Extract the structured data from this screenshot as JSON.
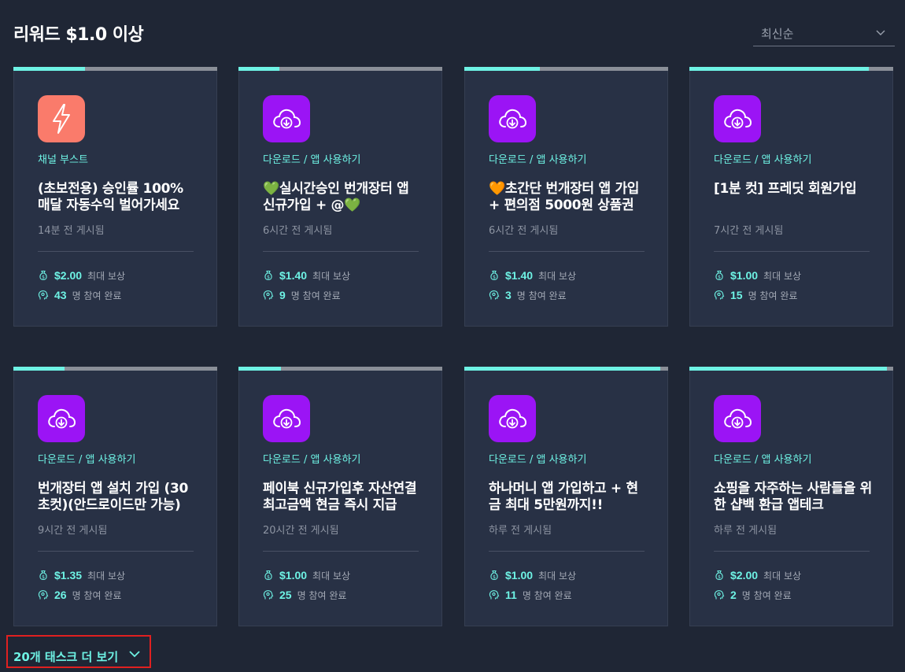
{
  "header": {
    "title": "리워드 $1.0 이상"
  },
  "sort": {
    "selected": "최신순"
  },
  "cards": [
    {
      "category": "채널 부스트",
      "title": "(초보전용) 승인률 100% 매달 자동수익 벌어가세요",
      "posted": "14분 전 게시됨",
      "reward": "$2.00",
      "reward_label": "최대 보상",
      "participants": "43",
      "participants_label": "명 참여 완료",
      "icon": "lightning-icon",
      "icon_color": "#fa7b6b",
      "progress": 0.35
    },
    {
      "category": "다운로드 / 앱 사용하기",
      "title": "💚실시간승인 번개장터 앱 신규가입 + @💚",
      "posted": "6시간 전 게시됨",
      "reward": "$1.40",
      "reward_label": "최대 보상",
      "participants": "9",
      "participants_label": "명 참여 완료",
      "icon": "cloud-download-icon",
      "icon_color": "#9b14f5",
      "progress": 0.2
    },
    {
      "category": "다운로드 / 앱 사용하기",
      "title": "🧡초간단 번개장터 앱 가입 + 편의점 5000원 상품권",
      "posted": "6시간 전 게시됨",
      "reward": "$1.40",
      "reward_label": "최대 보상",
      "participants": "3",
      "participants_label": "명 참여 완료",
      "icon": "cloud-download-icon",
      "icon_color": "#9b14f5",
      "progress": 0.37
    },
    {
      "category": "다운로드 / 앱 사용하기",
      "title": "[1분 컷] 프레딧 회원가입",
      "posted": "7시간 전 게시됨",
      "reward": "$1.00",
      "reward_label": "최대 보상",
      "participants": "15",
      "participants_label": "명 참여 완료",
      "icon": "cloud-download-icon",
      "icon_color": "#9b14f5",
      "progress": 0.88
    },
    {
      "category": "다운로드 / 앱 사용하기",
      "title": "번개장터 앱 설치 가입 (30초컷)(안드로이드만 가능)",
      "posted": "9시간 전 게시됨",
      "reward": "$1.35",
      "reward_label": "최대 보상",
      "participants": "26",
      "participants_label": "명 참여 완료",
      "icon": "cloud-download-icon",
      "icon_color": "#9b14f5",
      "progress": 0.25
    },
    {
      "category": "다운로드 / 앱 사용하기",
      "title": "페이북 신규가입후 자산연결 최고금액 현금 즉시 지급",
      "posted": "20시간 전 게시됨",
      "reward": "$1.00",
      "reward_label": "최대 보상",
      "participants": "25",
      "participants_label": "명 참여 완료",
      "icon": "cloud-download-icon",
      "icon_color": "#9b14f5",
      "progress": 0.21
    },
    {
      "category": "다운로드 / 앱 사용하기",
      "title": "하나머니 앱 가입하고 + 현금 최대 5만원까지!!",
      "posted": "하루 전 게시됨",
      "reward": "$1.00",
      "reward_label": "최대 보상",
      "participants": "11",
      "participants_label": "명 참여 완료",
      "icon": "cloud-download-icon",
      "icon_color": "#9b14f5",
      "progress": 0.96
    },
    {
      "category": "다운로드 / 앱 사용하기",
      "title": "쇼핑을 자주하는 사람들을 위한 샵백 환급 앱테크",
      "posted": "하루 전 게시됨",
      "reward": "$2.00",
      "reward_label": "최대 보상",
      "participants": "2",
      "participants_label": "명 참여 완료",
      "icon": "cloud-download-icon",
      "icon_color": "#9b14f5",
      "progress": 0.97
    }
  ],
  "more": {
    "label": "20개 태스크 더 보기"
  },
  "colors": {
    "background": "#1f2635",
    "card": "#283145",
    "accent": "#6ef2e4",
    "highlight_border": "#e02020"
  }
}
